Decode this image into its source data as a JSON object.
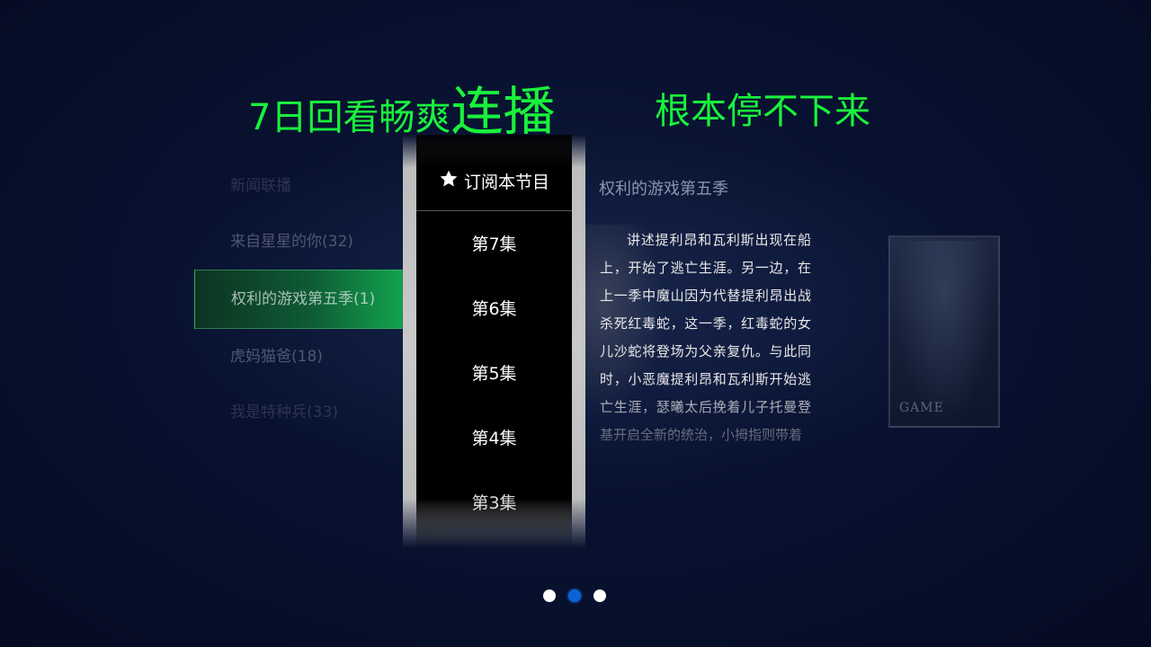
{
  "headline": {
    "left": "7日回看畅爽",
    "big": "连播",
    "right": "根本停不下来",
    "color": "#19f23c"
  },
  "categories": [
    {
      "label": "新闻联播",
      "state": "faded"
    },
    {
      "label": "来自星星的你(32)",
      "state": "dim"
    },
    {
      "label": "权利的游戏第五季(1)",
      "state": "active"
    },
    {
      "label": "虎妈猫爸(18)",
      "state": "dim"
    },
    {
      "label": "我是特种兵(33)",
      "state": "faded"
    }
  ],
  "episode_panel": {
    "subscribe_label": "订阅本节目",
    "subscribe_icon": "star-icon",
    "episodes": [
      "第7集",
      "第6集",
      "第5集",
      "第4集",
      "第3集"
    ]
  },
  "detail": {
    "title": "权利的游戏第五季",
    "description": "讲述提利昂和瓦利斯出现在船上，开始了逃亡生涯。另一边，在上一季中魔山因为代替提利昂出战杀死红毒蛇，这一季，红毒蛇的女儿沙蛇将登场为父亲复仇。与此同时，小恶魔提利昂和瓦利斯开始逃亡生涯，瑟曦太后挽着儿子托曼登基开启全新的统治，小拇指则带着",
    "poster_logo": "GAME"
  },
  "pagination": {
    "count": 3,
    "active_index": 1,
    "active_color": "#0a63d8"
  }
}
